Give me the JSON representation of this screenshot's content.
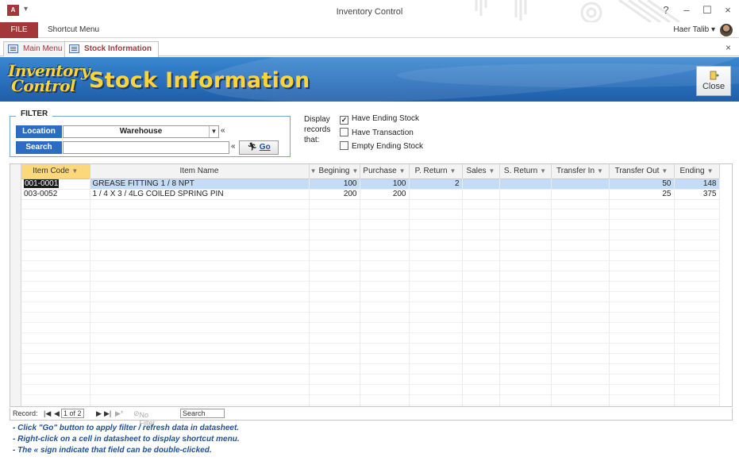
{
  "window": {
    "app_icon": "A",
    "title": "Inventory Control",
    "controls": [
      "?",
      "–",
      "☐",
      "×"
    ]
  },
  "ribbon": {
    "file_tab": "FILE",
    "shortcut_menu": "Shortcut Menu",
    "user_name": "Haer Talib"
  },
  "doc_tabs": {
    "main_menu": "Main Menu",
    "stock_information": "Stock Information",
    "close_glyph": "×"
  },
  "header": {
    "logo_line1": "Inventory",
    "logo_line2": "Control",
    "title": "Stock Information",
    "close_label": "Close"
  },
  "filter": {
    "title": "FILTER",
    "location_label": "Location",
    "location_value": "Warehouse",
    "search_label": "Search",
    "search_value": "",
    "dbl_marker": "«",
    "go_label": "Go"
  },
  "display": {
    "line1": "Display",
    "line2": "records",
    "line3": "that:",
    "options": [
      {
        "label": "Have Ending Stock",
        "checked": true
      },
      {
        "label": "Have Transaction",
        "checked": false
      },
      {
        "label": "Empty Ending Stock",
        "checked": false
      }
    ]
  },
  "datasheet": {
    "columns": [
      "Item Code",
      "Item Name",
      "Begining",
      "Purchase",
      "P. Return",
      "Sales",
      "S. Return",
      "Transfer In",
      "Transfer Out",
      "Ending"
    ],
    "rows": [
      {
        "code": "001-0001",
        "name": "GREASE FITTING 1 / 8 NPT",
        "begining": "100",
        "purchase": "100",
        "p_return": "2",
        "sales": "",
        "s_return": "",
        "transfer_in": "",
        "transfer_out": "50",
        "ending": "148"
      },
      {
        "code": "003-0052",
        "name": "1 / 4 X 3 / 4LG COILED SPRING PIN",
        "begining": "200",
        "purchase": "200",
        "p_return": "",
        "sales": "",
        "s_return": "",
        "transfer_in": "",
        "transfer_out": "25",
        "ending": "375"
      }
    ]
  },
  "nav": {
    "record_label": "Record:",
    "position": "1 of 2",
    "no_filter": "No Filter",
    "search": "Search"
  },
  "notes": [
    "- Click \"Go\" button to apply filter / refresh data in datasheet.",
    "- Right-click on a cell in datasheet to display shortcut menu.",
    "- The « sign indicate that field can be double-clicked."
  ],
  "colors": {
    "accent_red": "#a4373a",
    "banner_blue": "#2c74c0",
    "title_yellow": "#ffd43a",
    "label_blue": "#2c6cc2",
    "selected_row": "#c4dcf5",
    "sorted_header": "#fbd87a"
  }
}
